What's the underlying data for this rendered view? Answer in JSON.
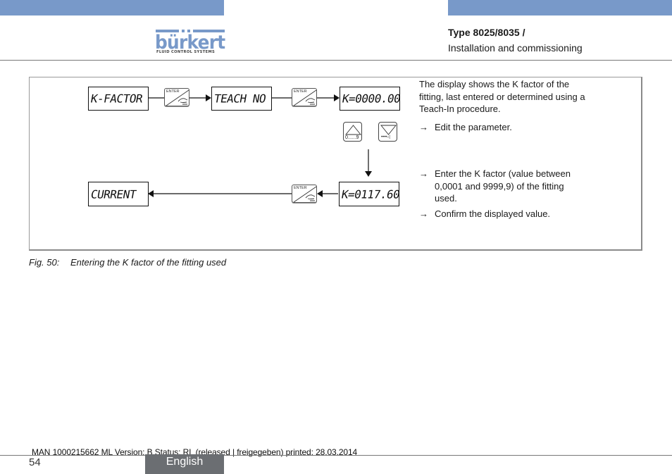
{
  "header": {
    "brand": "bürkert",
    "brand_tagline": "FLUID CONTROL SYSTEMS",
    "doc_type": "Type 8025/8035 /",
    "doc_section": "Installation and commissioning",
    "accent_color": "#7899c9"
  },
  "figure": {
    "displays": {
      "k_factor": "K-FACTOR",
      "teach_no": "TEACH NO",
      "k_initial": "K=0000.00",
      "current": "CURRENT",
      "k_entered": "K=0117.60"
    },
    "keys": {
      "enter_label": "ENTER",
      "up_key_sublabel": "0......9",
      "down_key_sublabel": "••••◁"
    },
    "descriptions": {
      "intro": "The display shows the K factor of the fitting, last entered or determined using a Teach-In procedure.",
      "step_edit": "Edit the parameter.",
      "step_enter": "Enter the K factor (value between 0,0001 and 9999,9) of the fitting used.",
      "step_confirm": "Confirm the displayed value.",
      "arrow_glyph": "→"
    },
    "caption_label": "Fig. 50:",
    "caption_text": "Entering the K factor of the fitting used"
  },
  "footer": {
    "meta": "MAN  1000215662  ML  Version: B Status: RL (released | freigegeben)  printed: 28.03.2014",
    "page_number": "54",
    "language": "English",
    "language_tab_color": "#6b6e72"
  }
}
